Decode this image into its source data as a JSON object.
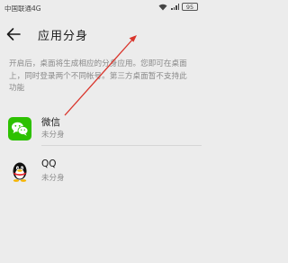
{
  "status_bar": {
    "carrier": "中国联通4G",
    "signal": "4G",
    "battery": "95"
  },
  "header": {
    "title": "应用分身"
  },
  "description": "开启后，桌面将生成相应的分身应用。您即可在桌面上，同时登录两个不同帐号。第三方桌面暂不支持此功能",
  "apps": [
    {
      "name": "微信",
      "status": "未分身",
      "icon": "wechat-icon"
    },
    {
      "name": "QQ",
      "status": "未分身",
      "icon": "qq-icon"
    }
  ],
  "colors": {
    "accent_arrow": "#d9342b",
    "wechat_green": "#2dc100",
    "background": "#ececec"
  }
}
